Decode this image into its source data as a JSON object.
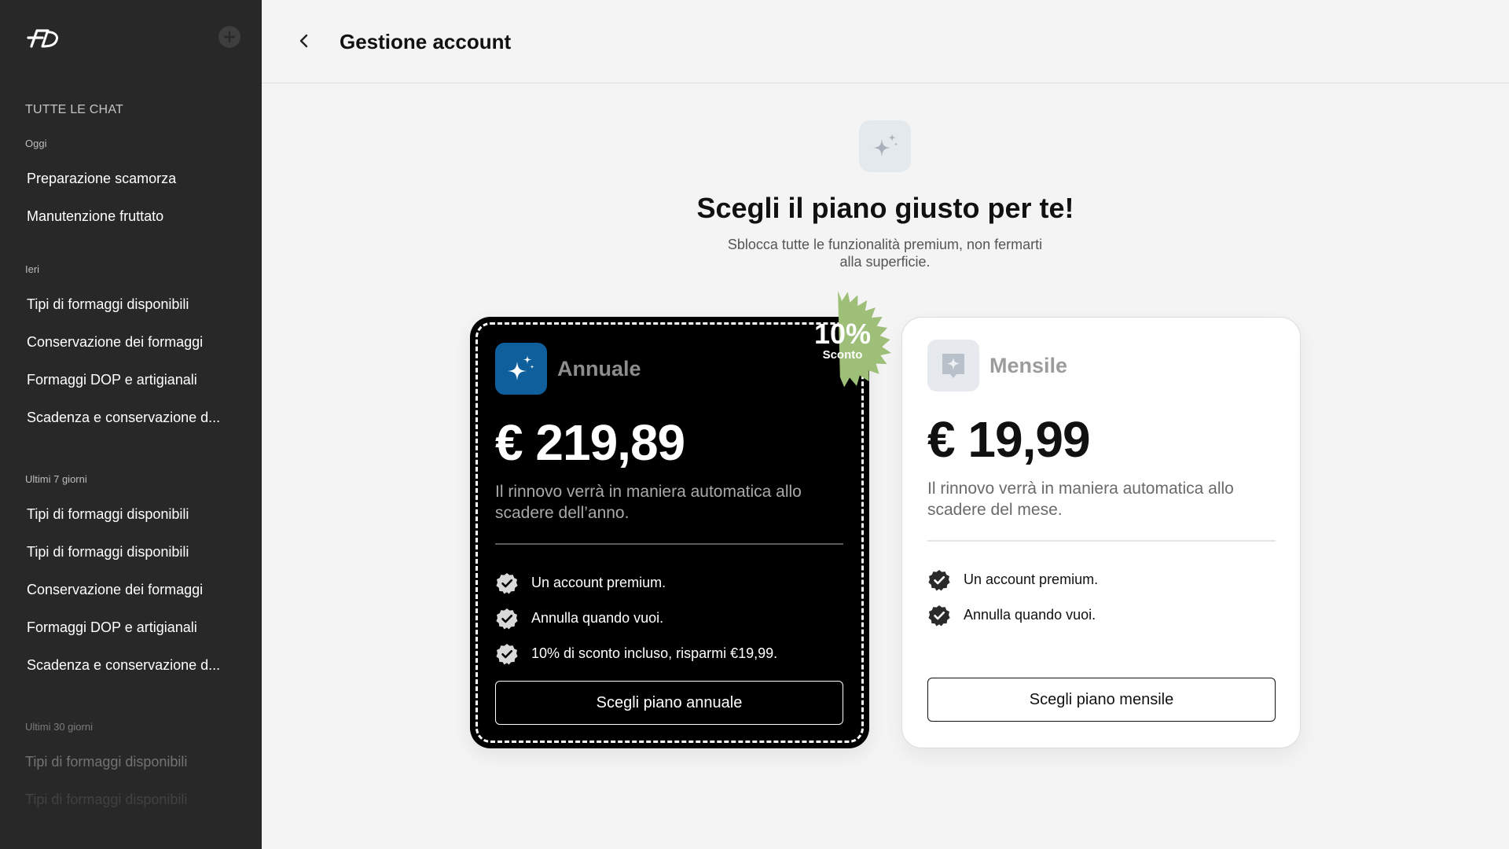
{
  "sidebar": {
    "logo_text": "FD",
    "new_chat_icon": "plus-circle-icon",
    "section_title": "TUTTE LE CHAT",
    "groups": [
      {
        "label": "Oggi",
        "items": [
          "Preparazione scamorza",
          "Manutenzione fruttato"
        ]
      },
      {
        "label": "Ieri",
        "items": [
          "Tipi di formaggi disponibili",
          "Conservazione dei formaggi",
          "Formaggi DOP e artigianali",
          "Scadenza e conservazione d..."
        ]
      },
      {
        "label": "Ultimi 7 giorni",
        "items": [
          "Tipi di formaggi disponibili",
          "Tipi di formaggi disponibili",
          "Conservazione dei formaggi",
          "Formaggi DOP e artigianali",
          "Scadenza e conservazione d..."
        ]
      },
      {
        "label": "Ultimi 30 giorni",
        "items": [
          "Tipi di formaggi disponibili",
          "Tipi di formaggi disponibili"
        ]
      }
    ]
  },
  "header": {
    "title": "Gestione account",
    "back_icon": "chevron-left-icon"
  },
  "hero": {
    "icon": "sparkles-icon",
    "headline": "Scegli il piano giusto per te!",
    "subheadline": "Sblocca tutte le funzionalità premium, non fermarti alla superficie."
  },
  "plans": {
    "annual": {
      "name": "Annuale",
      "price": "€ 219,89",
      "description": "Il rinnovo verrà in maniera automatica allo scadere dell’anno.",
      "features": [
        "Un account premium.",
        "Annulla quando vuoi.",
        "10% di sconto incluso, risparmi €19,99."
      ],
      "button_label": "Scegli piano annuale",
      "icon": "sparkles-icon",
      "badge": {
        "percent": "10%",
        "label": "Sconto"
      }
    },
    "monthly": {
      "name": "Mensile",
      "price": "€ 19,99",
      "description": "Il rinnovo verrà in maniera automatica allo scadere del mese.",
      "features": [
        "Un account premium.",
        "Annulla quando vuoi."
      ],
      "button_label": "Scegli piano mensile",
      "icon": "star-badge-icon"
    }
  },
  "colors": {
    "sidebar_bg": "#282828",
    "main_bg": "#f4f4f4",
    "annual_icon_bg": "#0e5f9b",
    "badge_green": "#9dbf78",
    "card_dark": "#000000",
    "card_light": "#ffffff"
  }
}
